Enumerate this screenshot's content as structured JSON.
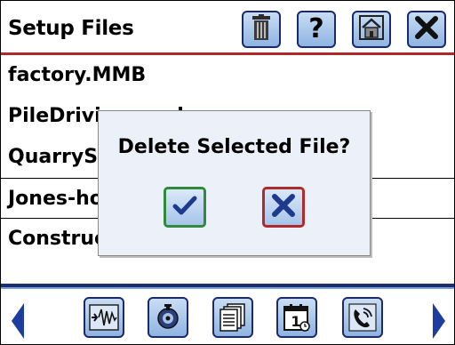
{
  "header": {
    "title": "Setup Files",
    "buttons": [
      {
        "name": "delete",
        "icon": "trash-icon"
      },
      {
        "name": "help",
        "icon": "question-icon",
        "label": "?"
      },
      {
        "name": "home",
        "icon": "home-icon"
      },
      {
        "name": "close",
        "icon": "close-icon"
      }
    ]
  },
  "files": [
    "factory.MMB",
    "PileDriving.mmb",
    "QuarrySite.mmb",
    "Jones-house.mmb",
    "Construction.mmb"
  ],
  "dialog": {
    "title": "Delete Selected File?",
    "ok_icon": "checkmark-icon",
    "cancel_icon": "close-icon"
  },
  "bottom_bar": {
    "buttons": [
      "waveform-icon",
      "settings-icon",
      "documents-icon",
      "calendar-icon",
      "phone-icon"
    ],
    "calendar_day": "1"
  },
  "colors": {
    "accent_red": "#b3262b",
    "navy": "#1b2f6e",
    "button_blue": "#a9c6ec",
    "ok_green": "#2f8a3a",
    "cancel_red": "#b02a2a"
  }
}
